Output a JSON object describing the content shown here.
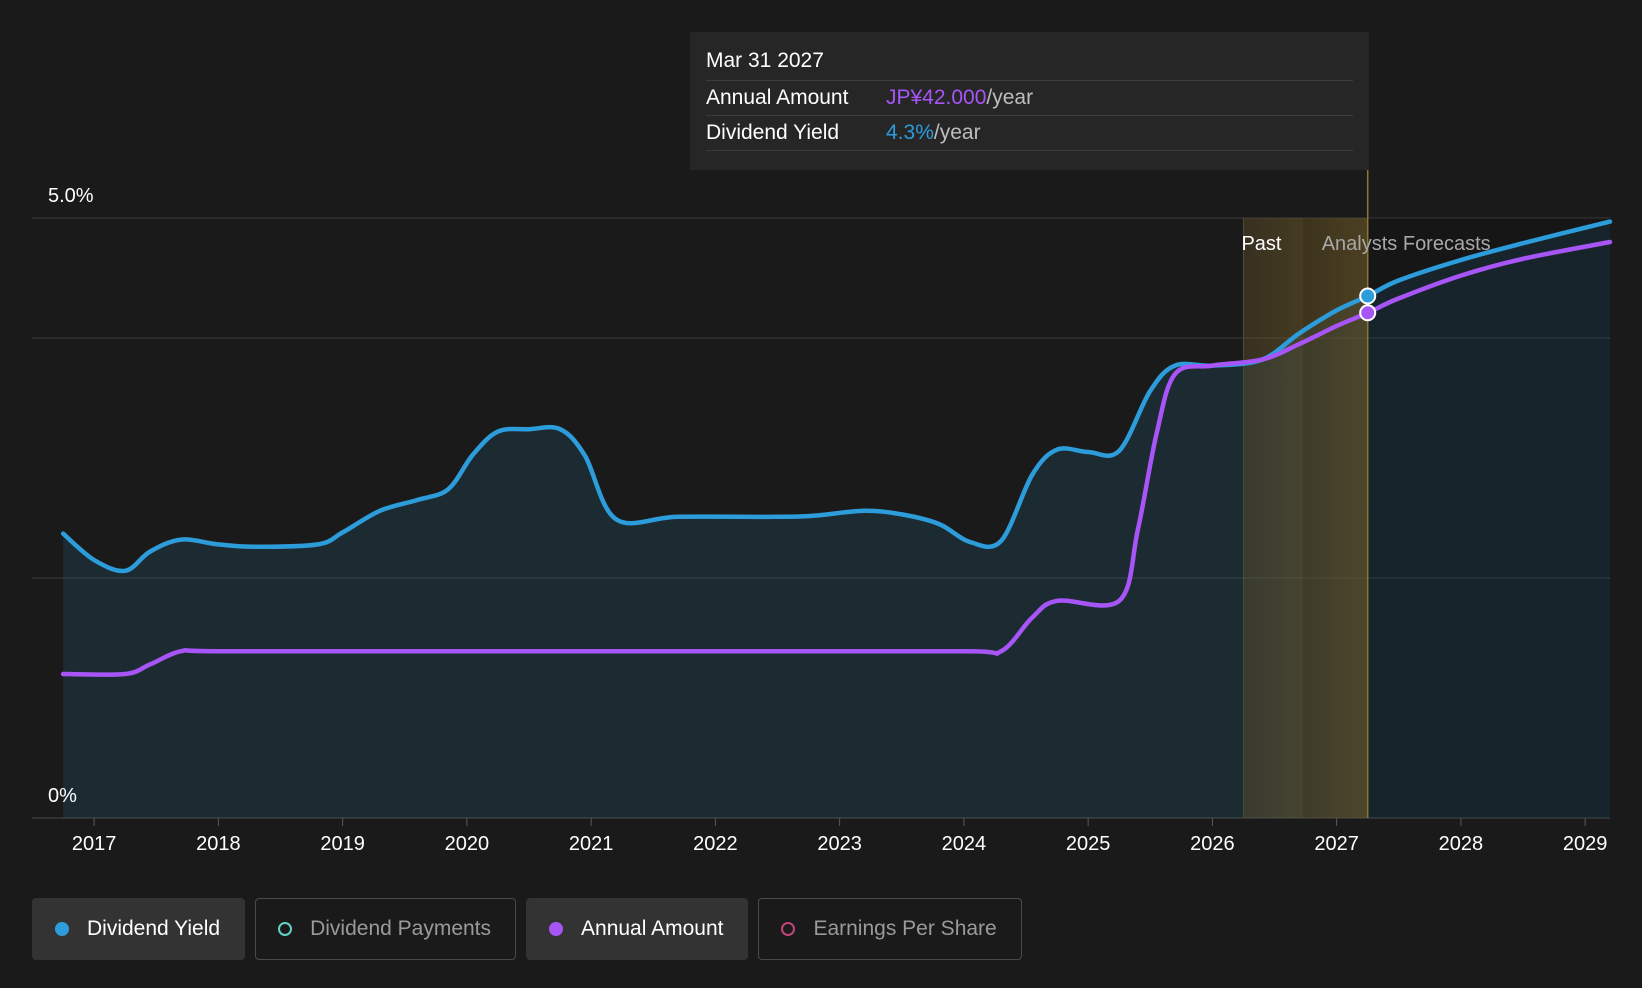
{
  "tooltip": {
    "date": "Mar 31 2027",
    "rows": [
      {
        "label": "Annual Amount",
        "value": "JP¥42.000",
        "unit": "/year",
        "color": "#a855f7"
      },
      {
        "label": "Dividend Yield",
        "value": "4.3%",
        "unit": "/year",
        "color": "#2d9cdb"
      }
    ]
  },
  "legend": [
    {
      "label": "Dividend Yield",
      "color": "#2d9cdb",
      "active": true,
      "filled": true
    },
    {
      "label": "Dividend Payments",
      "color": "#5fd4c4",
      "active": false,
      "filled": false
    },
    {
      "label": "Annual Amount",
      "color": "#a855f7",
      "active": true,
      "filled": true
    },
    {
      "label": "Earnings Per Share",
      "color": "#c0437a",
      "active": false,
      "filled": false
    }
  ],
  "chart_data": {
    "type": "line",
    "ylim": [
      0,
      5.0
    ],
    "y_tick_labels": [
      {
        "value": 5.0,
        "label": "5.0%"
      },
      {
        "value": 0,
        "label": "0%"
      }
    ],
    "y_gridlines": [
      5.0,
      4.0,
      2.0,
      0
    ],
    "x_ticks": [
      "2017",
      "2018",
      "2019",
      "2020",
      "2021",
      "2022",
      "2023",
      "2024",
      "2025",
      "2026",
      "2027",
      "2028",
      "2029"
    ],
    "xlim": [
      2016.5,
      2029.2
    ],
    "past_label": "Past",
    "forecast_label": "Analysts Forecasts",
    "past_band_start": 2026.25,
    "forecast_start": 2026.73,
    "hover_x": 2027.25,
    "series": [
      {
        "name": "Dividend Yield",
        "color": "#2d9cdb",
        "x": [
          2016.75,
          2017.0,
          2017.25,
          2017.45,
          2017.7,
          2018.0,
          2018.3,
          2018.8,
          2019.0,
          2019.3,
          2019.6,
          2019.85,
          2020.05,
          2020.25,
          2020.5,
          2020.75,
          2020.95,
          2021.2,
          2021.7,
          2022.5,
          2022.8,
          2023.2,
          2023.5,
          2023.8,
          2024.05,
          2024.3,
          2024.55,
          2024.75,
          2025.0,
          2025.25,
          2025.5,
          2025.7,
          2026.0,
          2026.4,
          2026.7,
          2027.0,
          2027.25,
          2027.5,
          2028.0,
          2028.5,
          2029.2
        ],
        "values": [
          2.37,
          2.15,
          2.06,
          2.22,
          2.32,
          2.28,
          2.26,
          2.28,
          2.38,
          2.56,
          2.65,
          2.74,
          3.03,
          3.22,
          3.24,
          3.24,
          3.02,
          2.49,
          2.51,
          2.51,
          2.52,
          2.56,
          2.53,
          2.45,
          2.3,
          2.31,
          2.86,
          3.07,
          3.05,
          3.06,
          3.56,
          3.77,
          3.77,
          3.82,
          4.04,
          4.23,
          4.35,
          4.48,
          4.65,
          4.79,
          4.97
        ]
      },
      {
        "name": "Annual Amount",
        "color": "#a855f7",
        "x": [
          2016.75,
          2017.25,
          2017.45,
          2017.7,
          2018.0,
          2020.0,
          2022.0,
          2024.0,
          2024.3,
          2024.55,
          2024.75,
          2025.25,
          2025.4,
          2025.55,
          2025.7,
          2026.0,
          2026.4,
          2026.7,
          2027.0,
          2027.25,
          2027.5,
          2028.0,
          2028.5,
          2029.2
        ],
        "values": [
          1.2,
          1.2,
          1.28,
          1.39,
          1.39,
          1.39,
          1.39,
          1.39,
          1.39,
          1.67,
          1.81,
          1.81,
          2.4,
          3.2,
          3.7,
          3.77,
          3.82,
          3.95,
          4.1,
          4.21,
          4.33,
          4.52,
          4.66,
          4.8
        ]
      }
    ]
  }
}
